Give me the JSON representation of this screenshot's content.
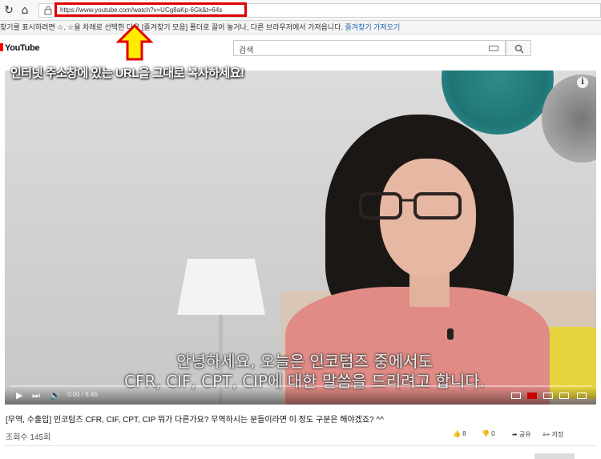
{
  "browser": {
    "url": "https://www.youtube.com/watch?v=UCg8aKp-6Gk&t=64s",
    "bookmark_bar_text": "찾기를 표시하려면 ☆. ☆을 차례로 선택한 다음 [즐겨찾기 모음] 폴더로 끌어 놓거나, 다른 브라우저에서 가져옵니다.",
    "bookmark_bar_link": "즐겨찾기 가져오기"
  },
  "youtube": {
    "logo_text": "YouTube",
    "search_placeholder": "검색"
  },
  "annotation": {
    "text": "인터넷 주소창에 있는 URL을 그대로 복사하세요!",
    "arrow_color": "#e00000",
    "arrow_fill": "#ffea00",
    "highlight_color": "#e00000"
  },
  "video": {
    "subtitle_line1": "안녕하세요, 오늘은 인코텀즈 중에서도",
    "subtitle_line2": "CFR, CIF, CPT, CIP에 대한 말씀을 드리려고 합니다.",
    "time": "0:00 / 6:45",
    "progress": 0.0
  },
  "meta": {
    "title": "[무역, 수출입] 인코텀즈 CFR, CIF, CPT, CIP 뭐가 다른가요? 무역하시는 분들이라면 이 정도 구분은 해야겠죠? ^^",
    "views": "조회수 145회",
    "likes": "8",
    "dislikes": "0",
    "share_label": "공유",
    "save_label": "저장"
  }
}
